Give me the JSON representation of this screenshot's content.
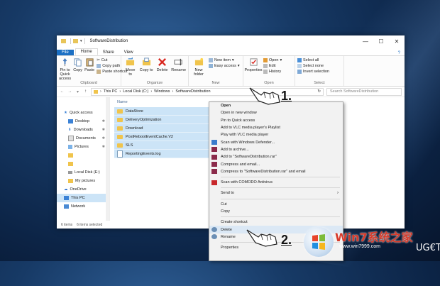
{
  "window": {
    "title": "SoftwareDistribution",
    "controls": [
      "—",
      "☐",
      "✕"
    ]
  },
  "ribbon": {
    "tabs": [
      "File",
      "Home",
      "Share",
      "View"
    ],
    "clipboard": {
      "pin": "Pin to Quick access",
      "copy": "Copy",
      "paste": "Paste",
      "cut": "Cut",
      "copy_path": "Copy path",
      "paste_shortcut": "Paste shortcut",
      "label": "Clipboard"
    },
    "organize": {
      "move_to": "Move to",
      "copy_to": "Copy to",
      "delete": "Delete",
      "rename": "Rename",
      "label": "Organize"
    },
    "new": {
      "new_folder": "New folder",
      "new_item": "New item",
      "easy_access": "Easy access",
      "label": "New"
    },
    "open": {
      "properties": "Properties",
      "open": "Open",
      "edit": "Edit",
      "history": "History",
      "label": "Open"
    },
    "select": {
      "select_all": "Select all",
      "select_none": "Select none",
      "invert": "Invert selection",
      "label": "Select"
    }
  },
  "address": {
    "crumbs": [
      "This PC",
      "Local Disk (C:)",
      "Windows",
      "SoftwareDistribution"
    ],
    "search_placeholder": "Search SoftwareDistribution"
  },
  "nav": {
    "items": [
      {
        "label": "Quick access"
      },
      {
        "label": "Desktop"
      },
      {
        "label": "Downloads"
      },
      {
        "label": "Documents"
      },
      {
        "label": "Pictures"
      },
      {
        "label": ""
      },
      {
        "label": ""
      },
      {
        "label": "Local Disk (E:)"
      },
      {
        "label": "My pictures"
      },
      {
        "label": "OneDrive"
      },
      {
        "label": "This PC"
      },
      {
        "label": "Network"
      }
    ]
  },
  "files": {
    "column_name": "Name",
    "rows": [
      {
        "name": "DataStore",
        "type": "folder"
      },
      {
        "name": "DeliveryOptimization",
        "type": "folder"
      },
      {
        "name": "Download",
        "type": "folder"
      },
      {
        "name": "PostRebootEventCache.V2",
        "type": "folder"
      },
      {
        "name": "SLS",
        "type": "folder"
      },
      {
        "name": "ReportingEvents.log",
        "type": "file"
      }
    ]
  },
  "status": {
    "count": "6 items",
    "selected": "6 items selected"
  },
  "context_menu": {
    "items": [
      {
        "label": "Open",
        "bold": true
      },
      {
        "label": "Open in new window"
      },
      {
        "label": "Pin to Quick access"
      },
      {
        "label": "Add to VLC media player's Playlist"
      },
      {
        "label": "Play with VLC media player"
      },
      {
        "label": "Scan with Windows Defender..."
      },
      {
        "label": "Add to archive..."
      },
      {
        "label": "Add to \"SoftwareDistribution.rar\""
      },
      {
        "label": "Compress and email..."
      },
      {
        "label": "Compress to \"SoftwareDistribution.rar\" and email"
      },
      {
        "label": "Scan with COMODO Antivirus"
      },
      {
        "label": "Send to"
      },
      {
        "label": "Cut"
      },
      {
        "label": "Copy"
      },
      {
        "label": "Create shortcut"
      },
      {
        "label": "Delete"
      },
      {
        "label": "Rename"
      },
      {
        "label": "Properties"
      }
    ]
  },
  "annotations": {
    "step1": "1.",
    "step2": "2."
  },
  "watermark": {
    "brand": "Win7系统之家",
    "url": "www.win7999.com",
    "ugetfix": "UG€T"
  },
  "colors": {
    "accent": "#1a6fc4",
    "selection": "#cce4f7",
    "folder": "#f0c44c",
    "desktop": "#173a66"
  }
}
